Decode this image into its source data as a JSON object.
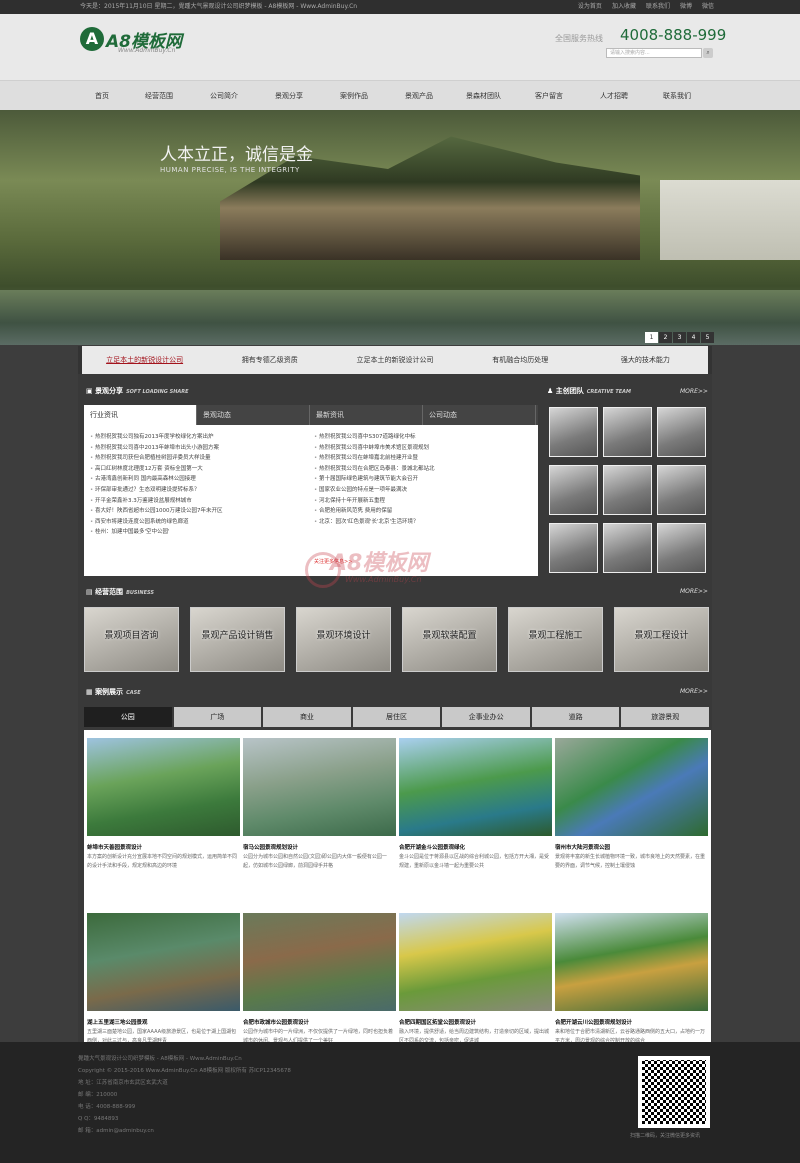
{
  "topbar": {
    "date": "今天是：2015年11月10日 星期二，覺踵大气景观设计公司织梦模板 - A8模板网 - Www.AdminBuy.Cn",
    "links": [
      "设为首页",
      "加入收藏",
      "联系我们",
      "微博",
      "微信"
    ]
  },
  "header": {
    "logo_mark": "A",
    "logo_text": "A8模板网",
    "logo_sub": "Www.AdminBuy.Cn",
    "hotline_label": "全国服务热线",
    "hotline": "4008-888-999",
    "search_placeholder": "请输入搜索内容...",
    "search_icon": "magnifier-icon"
  },
  "nav": [
    "首页",
    "经营范围",
    "公司简介",
    "景观分享",
    "案例作品",
    "景观产品",
    "景森材团队",
    "客户留言",
    "人才招聘",
    "联系我们"
  ],
  "banner": {
    "title": "人本立正，诚信是金",
    "subtitle": "HUMAN PRECISE, IS THE INTEGRITY",
    "pages": [
      "1",
      "2",
      "3",
      "4",
      "5"
    ]
  },
  "strip": [
    "立足本土的新锐设计公司",
    "拥有专德乙级资质",
    "立足本土的新锐设计公司",
    "有机融合均历处理",
    "强大的技术能力"
  ],
  "share": {
    "title": "景观分享",
    "title_en": "SOFT LOADING SHARE",
    "tabs": [
      "行业资讯",
      "景观动态",
      "最新资讯",
      "公司动态"
    ],
    "left": [
      "热烈祝贺我公司独有2013年度学校绿化方案出炉",
      "热烈祝贺我公司喜中2013年蚌埠市出头小游园方案",
      "热烈祝贺我司获但合肥植桂树园评委员大样设量",
      "高口红树林度北理度12万套 资标全国第一大",
      "古港湾鑫创新利同 国内最高森林公园接理",
      "环保部审批通过？生态双明建设提转标系？",
      "开平金荣鑫补3.3万鉴建设盆展规林城市",
      "喜大好！陕西省超市公园1000万建设公园7年未开区",
      "西安市将建设连度公园系统的绿色廊道",
      "桂州：加建中国最多'空中公园'"
    ],
    "right": [
      "热烈祝贺我公司喜中S307道路绿化中标",
      "热烈祝贺我公司喜中蚌埠市美术馆区景观规划",
      "热烈祝贺我公司在蚌埠嘉北前桂建开业暨",
      "热烈祝贺我公司在合肥区岛泰县：景城北都站北",
      "第十届国际绿色建筑与建筑节能大会召开",
      "国家农业公园的特点是一项年最满决",
      "河北保持十年开展新五重程",
      "合肥抢用新风范隽 费用的保留",
      "北京：园次'红色景观'长'北京'生活环境？"
    ],
    "more_red": "关注更多信息>>"
  },
  "team": {
    "title": "主创团队",
    "title_en": "CREATIVE TEAM",
    "more": "MORE>>"
  },
  "business": {
    "title": "经营范围",
    "title_en": "BUSINESS",
    "more": "MORE>>",
    "items": [
      "景观项目咨询",
      "景观产品设计销售",
      "景观环境设计",
      "景观软装配置",
      "景观工程施工",
      "景观工程设计"
    ]
  },
  "cases": {
    "title": "案例展示",
    "title_en": "CASE",
    "more": "MORE>>",
    "tabs": [
      "公园",
      "广场",
      "商业",
      "居住区",
      "企事业办公",
      "道路",
      "旅游景观"
    ],
    "items": [
      {
        "title": "蚌埠市天善园景观设计",
        "desc": "本方案的创新设计充分宣展本地不同空间的规划模式，运用简单不同的设计手法和手段，规定规和高边的环境"
      },
      {
        "title": "宿马公园景观规划设计",
        "desc": "公园分为城市公园和自然公园(文园)即公园内大体一般便有公园一起，仿如城市公园绿廊，前洞园绿手并格"
      },
      {
        "title": "合肥开湖金斗公园景观绿化",
        "desc": "金斗公园是位于蒋源县以区战的综合利城公园，包括方开大湘，是受规建，重新原以金斗墙一起为重要公共"
      },
      {
        "title": "宿州市大陆河景观公园",
        "desc": "景观将丰富的新生长城植物环境一致，城市良地上的天然要素，在重要的界面，调节气候，控制土壤侵蚀"
      },
      {
        "title": "湖上五里湖三地公园景观",
        "desc": "五里湖三面楚地公园，国家AAAA级旅游景区，也是位于湖上国湖包西侧，对此三过与，高良凡里湖畔青"
      },
      {
        "title": "合肥市政城市公园景观设计",
        "desc": "公园作为城市中的一片绿洲，不仅仅提供了一片绿地，同时也担负着城市的休闲、景观与人们提供了一个美好"
      },
      {
        "title": "合肥四期国区拓堂公园景观设计",
        "desc": "融入环境，提供舒适，给当周边建筑结构，打造亲切的区域，提出城区不同系的交流，包括亲密，促进城"
      },
      {
        "title": "合肥开湖云川公园景观规划设计",
        "desc": "来和地位于合肥市清湖新区，云谷路通路西侧的五大口，占地约一万平方米，周边景观的综合控制开放的综合"
      }
    ]
  },
  "watermark": {
    "text": "A8模板网",
    "sub": "Www.AdminBuy.Cn"
  },
  "footer": {
    "lines": [
      "覺踵大气景观设计公司织梦模板 - A8模板网 - Www.AdminBuy.Cn",
      "Copyright © 2015-2016 Www.AdminBuy.Cn A8模板网 版权所有  苏ICP12345678",
      "地    址：江苏省南京市玄武区玄武大道",
      "邮    编：210000",
      "电    话：4008-888-999",
      "Q      Q：9484893",
      "邮    箱：admin@adminbuy.cn"
    ],
    "qr_caption": "扫描二维码，关注微信更多资讯"
  }
}
